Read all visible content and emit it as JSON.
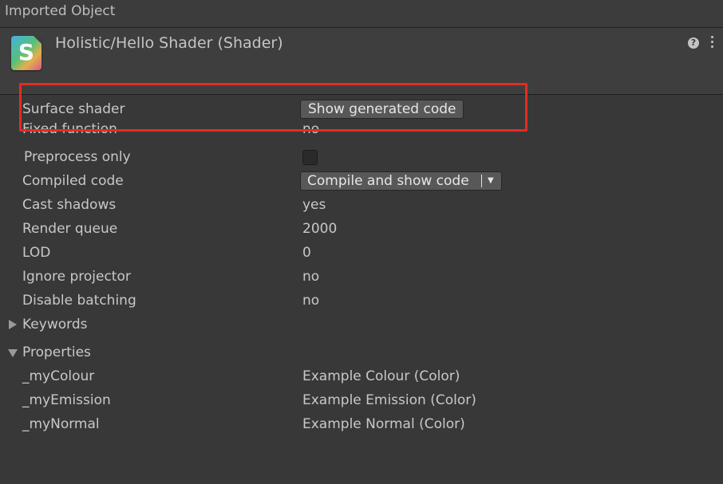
{
  "panel": {
    "title": "Imported Object"
  },
  "header": {
    "icon_letter": "S",
    "asset_title": "Holistic/Hello Shader (Shader)",
    "help_icon": "?"
  },
  "properties_rows": {
    "surface_shader": {
      "label": "Surface shader",
      "button": "Show generated code"
    },
    "fixed_function": {
      "label": "Fixed function",
      "value": "no"
    },
    "preprocess_only": {
      "label": "Preprocess only",
      "checked": false
    },
    "compiled_code": {
      "label": "Compiled code",
      "dropdown": "Compile and show code",
      "arrow": "▼"
    },
    "cast_shadows": {
      "label": "Cast shadows",
      "value": "yes"
    },
    "render_queue": {
      "label": "Render queue",
      "value": "2000"
    },
    "lod": {
      "label": "LOD",
      "value": "0"
    },
    "ignore_projector": {
      "label": "Ignore projector",
      "value": "no"
    },
    "disable_batching": {
      "label": "Disable batching",
      "value": "no"
    }
  },
  "keywords": {
    "label": "Keywords",
    "expanded": false
  },
  "properties": {
    "label": "Properties",
    "expanded": true,
    "items": [
      {
        "name": "_myColour",
        "value": "Example Colour (Color)"
      },
      {
        "name": "_myEmission",
        "value": "Example Emission (Color)"
      },
      {
        "name": "_myNormal",
        "value": "Example Normal (Color)"
      }
    ]
  },
  "colors": {
    "background": "#383838",
    "highlight": "#e52b24",
    "text": "#c8c8c8"
  }
}
